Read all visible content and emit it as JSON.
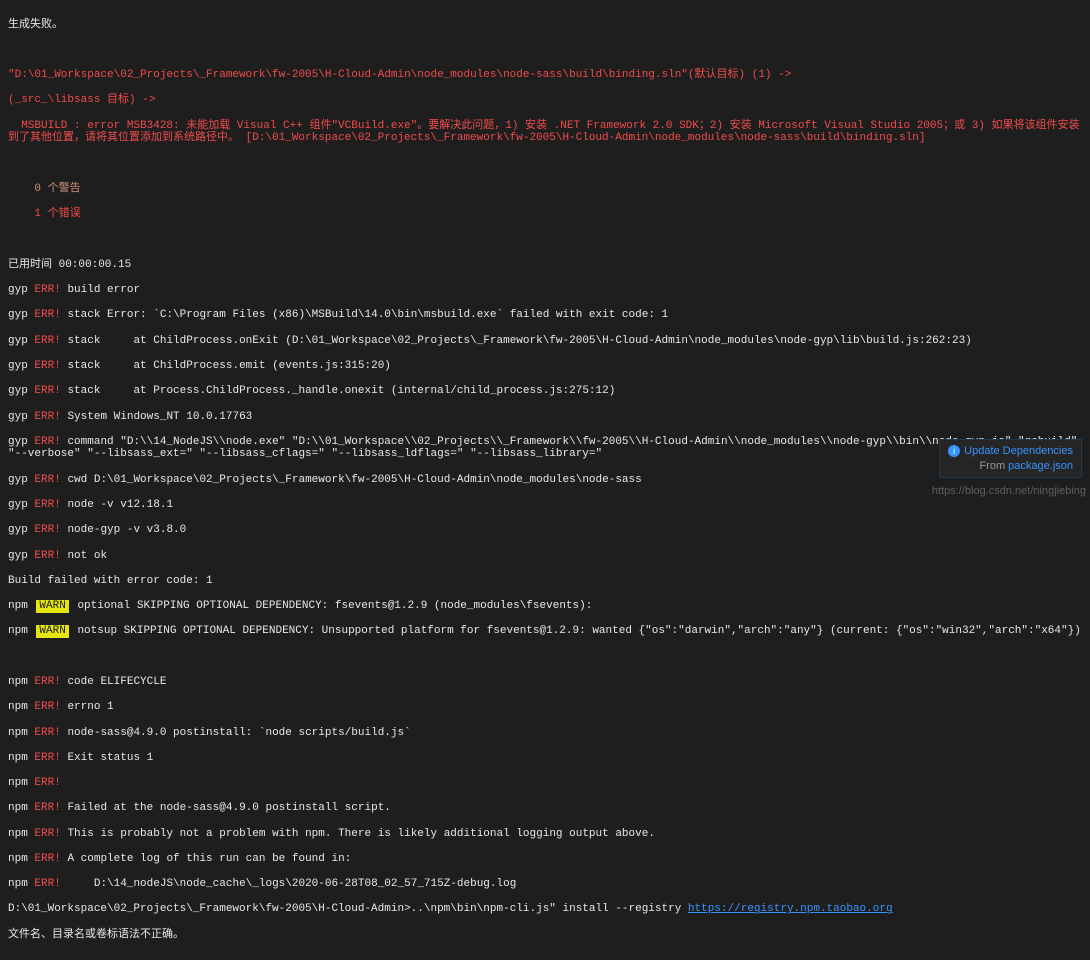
{
  "header": {
    "fail_msg": "生成失败。"
  },
  "msbuild": {
    "path_line": "\"D:\\01_Workspace\\02_Projects\\_Framework\\fw-2005\\H-Cloud-Admin\\node_modules\\node-sass\\build\\binding.sln\"(默认目标) (1) ->",
    "target_line": "(_src_\\libsass 目标) ->",
    "indent": "  ",
    "error_line": "MSBUILD : error MSB3428: 未能加载 Visual C++ 组件\"VCBuild.exe\"。要解决此问题，1) 安装 .NET Framework 2.0 SDK；2) 安装 Microsoft Visual Studio 2005；或 3) 如果将该组件安装到了其他位置，请将其位置添加到系统路径中。 [D:\\01_Workspace\\02_Projects\\_Framework\\fw-2005\\H-Cloud-Admin\\node_modules\\node-sass\\build\\binding.sln]",
    "warnings": "    0 个警告",
    "errors": "    1 个错误"
  },
  "elapsed": "已用时间 00:00:00.15",
  "gyp": {
    "prefix": "gyp",
    "err": "ERR!",
    "build_error": "build error",
    "stack1": "stack Error: `C:\\Program Files (x86)\\MSBuild\\14.0\\bin\\msbuild.exe` failed with exit code: 1",
    "stack2": "stack     at ChildProcess.onExit (D:\\01_Workspace\\02_Projects\\_Framework\\fw-2005\\H-Cloud-Admin\\node_modules\\node-gyp\\lib\\build.js:262:23)",
    "stack3": "stack     at ChildProcess.emit (events.js:315:20)",
    "stack4": "stack     at Process.ChildProcess._handle.onexit (internal/child_process.js:275:12)",
    "system": "System Windows_NT 10.0.17763",
    "command": "command \"D:\\\\14_NodeJS\\\\node.exe\" \"D:\\\\01_Workspace\\\\02_Projects\\\\_Framework\\\\fw-2005\\\\H-Cloud-Admin\\\\node_modules\\\\node-gyp\\\\bin\\\\node-gyp.js\" \"rebuild\" \"--verbose\" \"--libsass_ext=\" \"--libsass_cflags=\" \"--libsass_ldflags=\" \"--libsass_library=\"",
    "cwd": "cwd D:\\01_Workspace\\02_Projects\\_Framework\\fw-2005\\H-Cloud-Admin\\node_modules\\node-sass",
    "node_v": "node -v v12.18.1",
    "nodegyp_v": "node-gyp -v v3.8.0",
    "not_ok": "not ok"
  },
  "build_fail": "Build failed with error code: 1",
  "npm_warn": {
    "prefix": "npm",
    "warn": "WARN",
    "optional": "optional SKIPPING OPTIONAL DEPENDENCY: fsevents@1.2.9 (node_modules\\fsevents):",
    "notsup": "notsup SKIPPING OPTIONAL DEPENDENCY: Unsupported platform for fsevents@1.2.9: wanted {\"os\":\"darwin\",\"arch\":\"any\"} (current: {\"os\":\"win32\",\"arch\":\"x64\"})"
  },
  "npm_err": {
    "prefix": "npm",
    "err": "ERR!",
    "code": "code ELIFECYCLE",
    "errno": "errno 1",
    "postinstall": "node-sass@4.9.0 postinstall: `node scripts/build.js`",
    "exit": "Exit status 1",
    "blank": "",
    "failed": "Failed at the node-sass@4.9.0 postinstall script.",
    "probably": "This is probably not a problem with npm. There is likely additional logging output above.",
    "loglabel": "A complete log of this run can be found in:",
    "logpath": "    D:\\14_nodeJS\\node_cache\\_logs\\2020-06-28T08_02_57_715Z-debug.log"
  },
  "cmd_line": {
    "path": "D:\\01_Workspace\\02_Projects\\_Framework\\fw-2005\\H-Cloud-Admin>",
    "cmd_prefix": "..\\npm\\bin\\npm-cli.js\" install --registry ",
    "registry_url": "https://registry.npm.taobao.org"
  },
  "final": "文件名、目录名或卷标语法不正确。",
  "notif": {
    "title": "Update Dependencies",
    "from": "From ",
    "pkg": "package.json"
  },
  "watermark": "https://blog.csdn.net/ningjiebing"
}
